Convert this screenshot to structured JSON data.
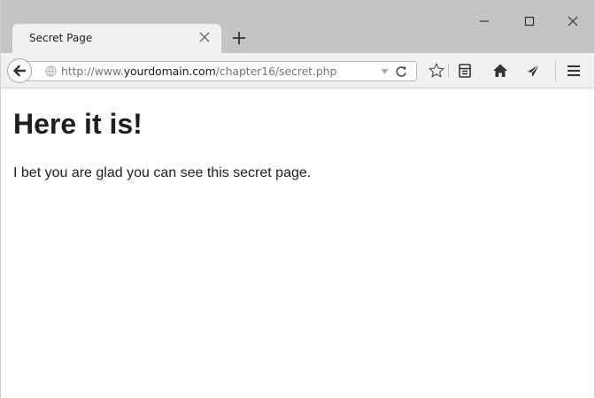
{
  "browser": {
    "tab": {
      "title": "Secret Page"
    },
    "window_controls": {
      "minimize": "minimize",
      "maximize": "maximize",
      "close": "close"
    },
    "address_bar": {
      "url_prefix": "http://www.",
      "url_host": "yourdomain.com",
      "url_path": "/chapter16/secret.php"
    },
    "toolbar_icons": [
      "back-icon",
      "globe-icon",
      "dropdown-icon",
      "reload-icon",
      "bookmark-star-icon",
      "reading-list-icon",
      "home-icon",
      "pocket-send-icon",
      "menu-icon"
    ]
  },
  "page": {
    "heading": "Here it is!",
    "paragraph": "I bet you are glad you can see this secret page."
  }
}
